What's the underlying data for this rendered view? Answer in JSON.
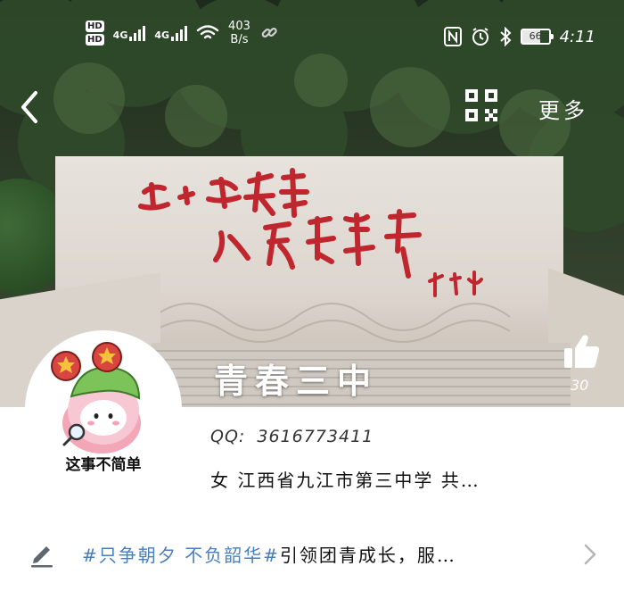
{
  "status_bar": {
    "hd1": "HD",
    "hd2": "HD",
    "net1": "4G",
    "net2": "4G",
    "speed_value": "403",
    "speed_unit": "B/s",
    "battery": "66",
    "time": "4:11"
  },
  "header": {
    "more_label": "更多"
  },
  "group": {
    "name": "青春三中",
    "likes": "30",
    "qq_label": "QQ:",
    "qq_number": "3616773411",
    "intro": "女  江西省九江市第三中学 共…",
    "motto_tag": "#只争朝夕 不负韶华#",
    "motto_body": "引领团青成长，服…"
  },
  "avatar": {
    "caption": "这事不简单"
  },
  "colors": {
    "tag_blue": "#4a7fbf",
    "calligraphy_red": "#c0262d"
  }
}
